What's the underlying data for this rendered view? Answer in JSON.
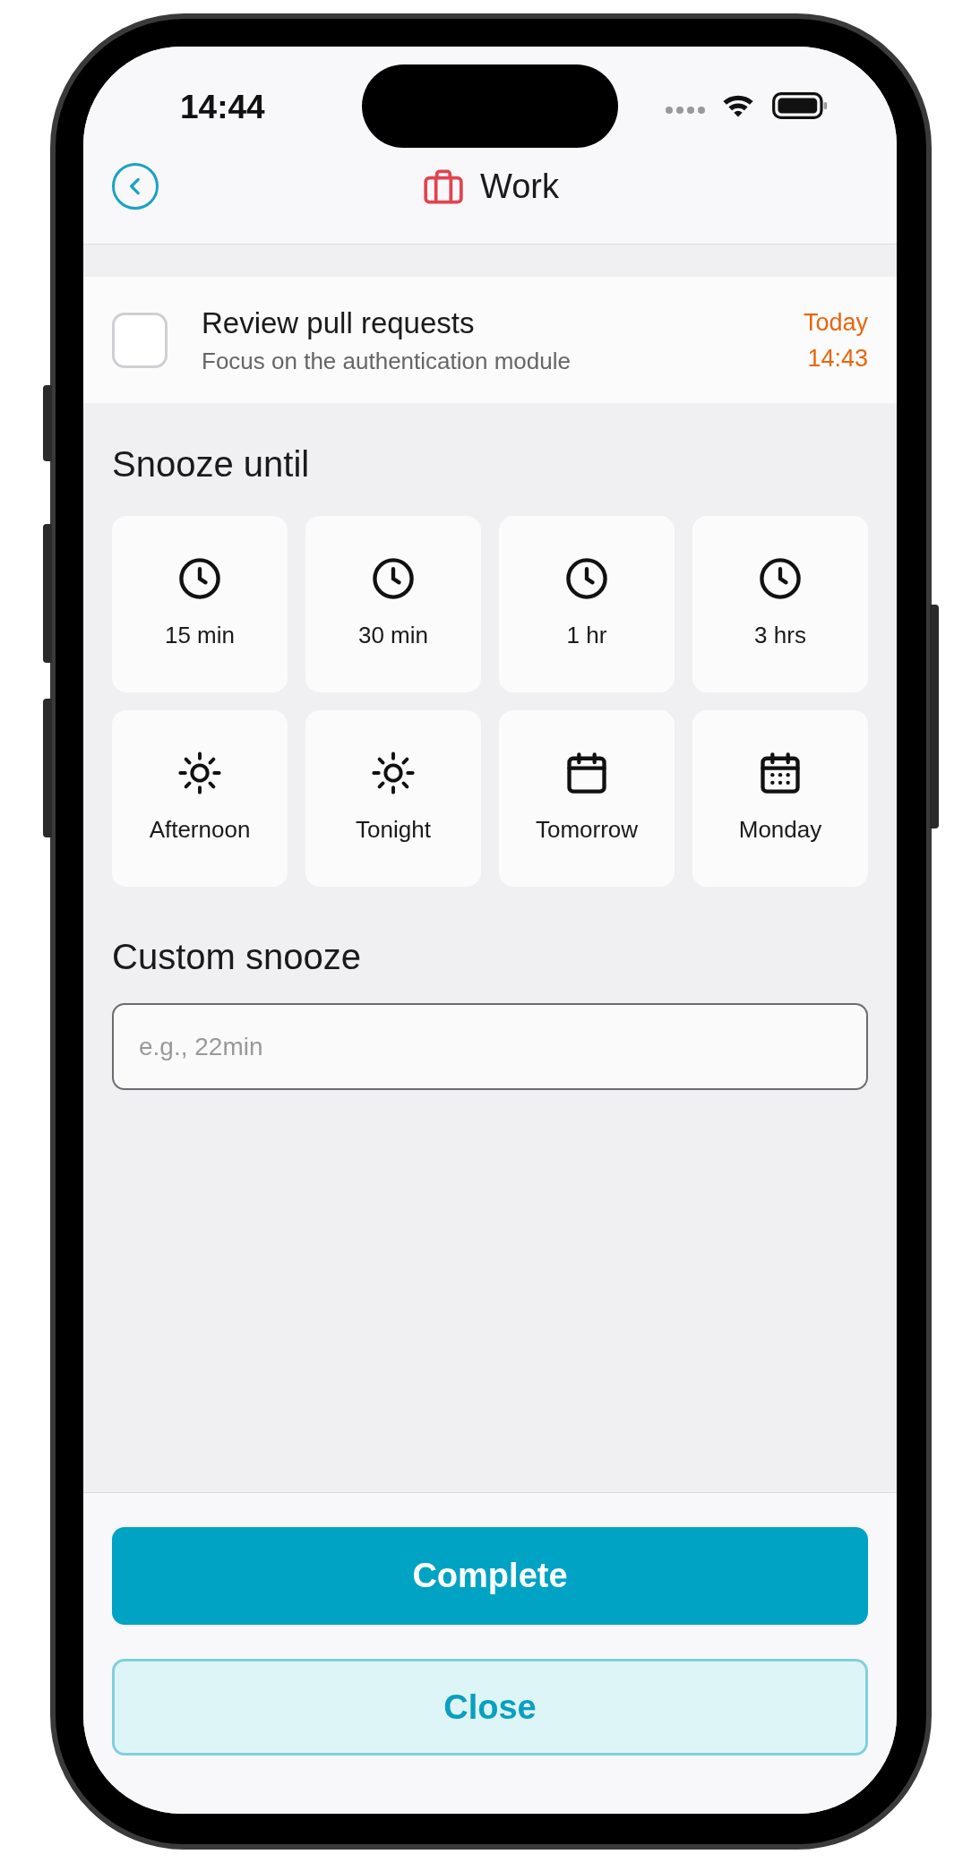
{
  "status_bar": {
    "time": "14:44"
  },
  "header": {
    "title": "Work"
  },
  "task": {
    "title": "Review pull requests",
    "note": "Focus on the authentication module",
    "checked": false,
    "due_day": "Today",
    "due_time": "14:43"
  },
  "snooze": {
    "heading": "Snooze until",
    "options": [
      {
        "label": "15 min",
        "kind": "clock"
      },
      {
        "label": "30 min",
        "kind": "clock"
      },
      {
        "label": "1 hr",
        "kind": "clock"
      },
      {
        "label": "3 hrs",
        "kind": "clock"
      },
      {
        "label": "Afternoon",
        "kind": "sun"
      },
      {
        "label": "Tonight",
        "kind": "sun"
      },
      {
        "label": "Tomorrow",
        "kind": "calendar"
      },
      {
        "label": "Monday",
        "kind": "calendar-grid"
      }
    ]
  },
  "custom": {
    "heading": "Custom snooze",
    "placeholder": "e.g., 22min"
  },
  "buttons": [
    {
      "label": "Complete",
      "kind": "primary"
    },
    {
      "label": "Close",
      "kind": "secondary"
    }
  ]
}
